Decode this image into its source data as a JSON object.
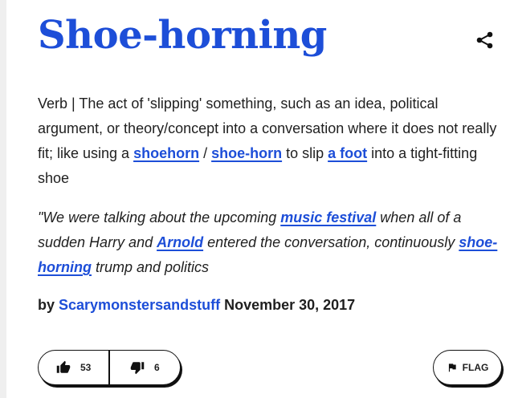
{
  "entry": {
    "word": "Shoe-horning",
    "meaning": {
      "part1": "Verb | The act of 'slipping' something, such as an idea, political argument, or theory/concept into a conversation where it does not really fit; like using a ",
      "link1": "shoehorn",
      "sep": " / ",
      "link2": "shoe-horn",
      "part2": " to slip ",
      "link3": "a foot",
      "part3": " into a tight-fitting shoe"
    },
    "example": {
      "part1": "\"We were talking about the upcoming ",
      "link1": "music festival",
      "part2": " when all of a sudden Harry and ",
      "link2": "Arnold",
      "part3": " entered the conversation, continuously ",
      "link3": "shoe-horning",
      "part4": " trump and politics"
    },
    "byline": {
      "by": "by ",
      "author": "Scarymonstersandstuff",
      "date": " November 30, 2017"
    }
  },
  "actions": {
    "upvotes": "53",
    "downvotes": "6",
    "flag_label": "FLAG"
  },
  "icons": {
    "share": "share-icon",
    "upvote": "thumbs-up-icon",
    "downvote": "thumbs-down-icon",
    "flag": "flag-icon"
  },
  "colors": {
    "link": "#1d4ed8",
    "text": "#1f1f1f",
    "border": "#111111"
  }
}
